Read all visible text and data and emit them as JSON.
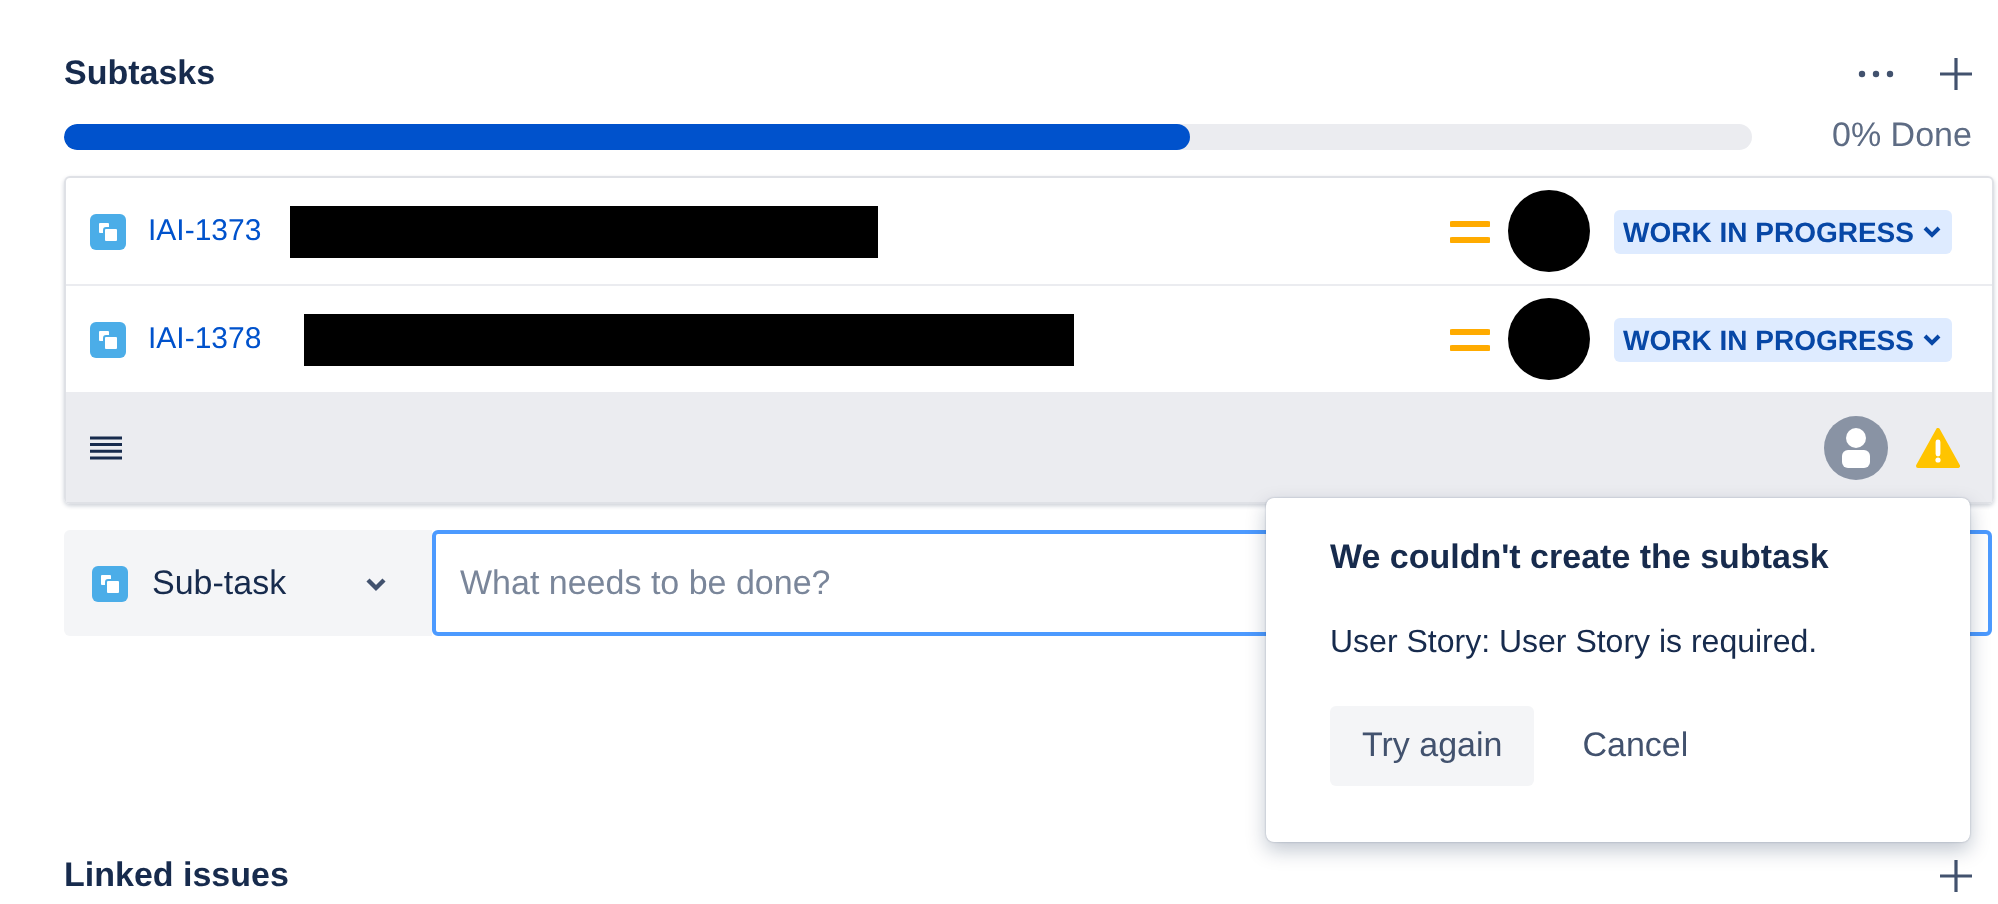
{
  "subtasks": {
    "title": "Subtasks",
    "progress": {
      "level": 0.667,
      "reading": "0% Done"
    },
    "rows": [
      {
        "key": "IAI-1373",
        "status": "WORK IN PROGRESS"
      },
      {
        "key": "IAI-1378",
        "status": "WORK IN PROGRESS"
      }
    ]
  },
  "composer": {
    "type": "Sub-task",
    "placeholder": "What needs to be done?"
  },
  "error_popup": {
    "title": "We couldn't create the subtask",
    "message": "User Story: User Story is required.",
    "buttons": [
      "Try again",
      "Cancel"
    ]
  },
  "linked_issues": {
    "title": "Linked issues"
  }
}
